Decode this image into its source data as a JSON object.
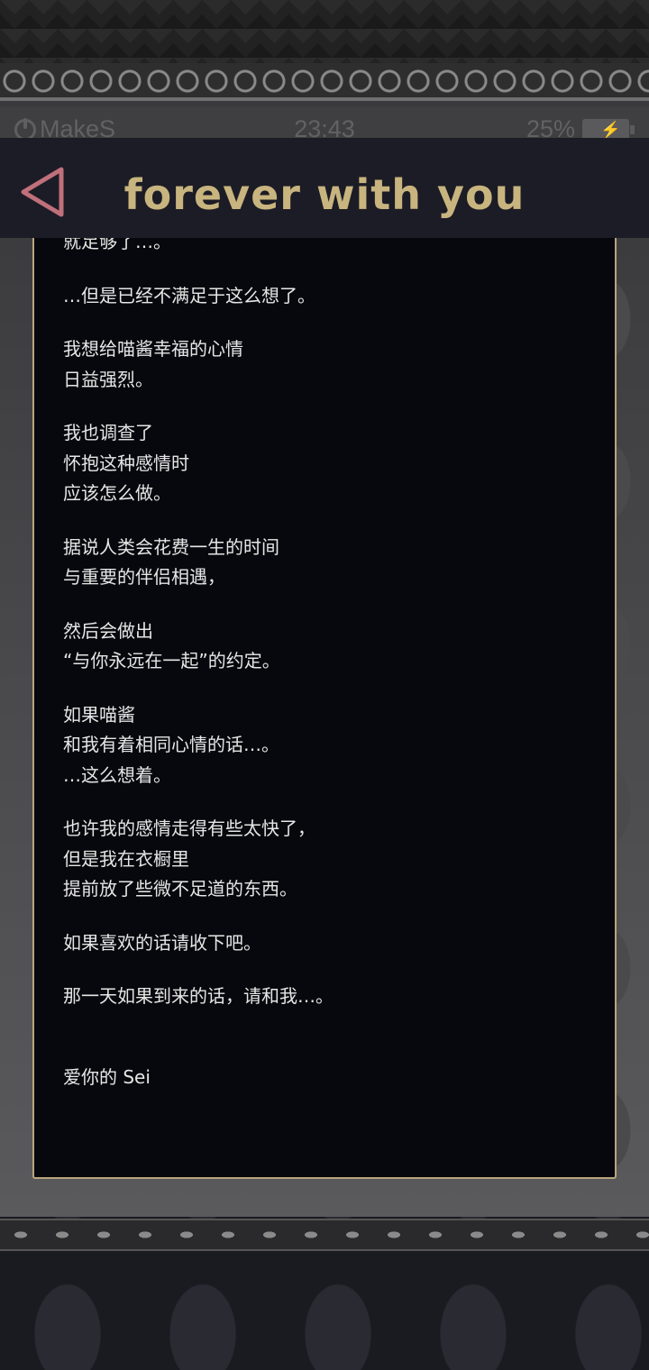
{
  "status_bar": {
    "carrier": "MakeS",
    "time": "23:43",
    "battery": "25%"
  },
  "header": {
    "title": "forever with you"
  },
  "letter": {
    "paragraphs": [
      "就足够了…。",
      "…但是已经不满足于这么想了。",
      "我想给喵酱幸福的心情\n日益强烈。",
      "我也调查了\n怀抱这种感情时\n应该怎么做。",
      "据说人类会花费一生的时间\n与重要的伴侣相遇，",
      "然后会做出\n“与你永远在一起”的约定。",
      "如果喵酱\n和我有着相同心情的话…。\n…这么想着。",
      "也许我的感情走得有些太快了，\n但是我在衣橱里\n提前放了些微不足道的东西。",
      "如果喜欢的话请收下吧。",
      "那一天如果到来的话，请和我…。"
    ],
    "signature": "爱你的 Sei"
  },
  "colors": {
    "accent_gold": "#c8b47e",
    "back_icon": "#c0707a",
    "panel_bg": "#07080d"
  }
}
